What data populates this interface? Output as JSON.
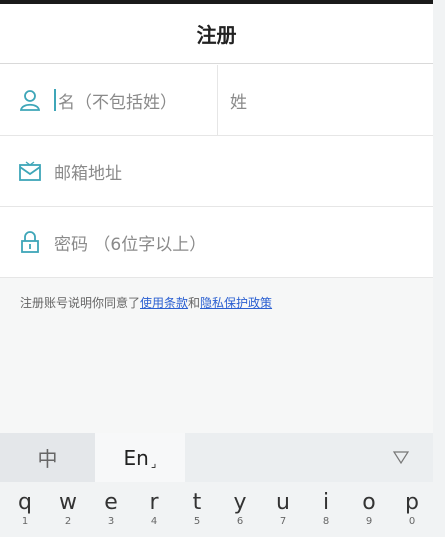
{
  "header": {
    "title": "注册"
  },
  "form": {
    "first_name_placeholder": "名（不包括姓）",
    "last_name_placeholder": "姓",
    "email_placeholder": "邮箱地址",
    "password_placeholder": "密码 （6位字以上）"
  },
  "terms": {
    "prefix": "注册账号说明你同意了",
    "terms_link": "使用条款",
    "and": "和",
    "privacy_link": "隐私保护政策"
  },
  "keyboard": {
    "tab_chinese": "中",
    "tab_english": "En",
    "english_mark": "⌟",
    "keys": [
      {
        "ch": "q",
        "num": "1"
      },
      {
        "ch": "w",
        "num": "2"
      },
      {
        "ch": "e",
        "num": "3"
      },
      {
        "ch": "r",
        "num": "4"
      },
      {
        "ch": "t",
        "num": "5"
      },
      {
        "ch": "y",
        "num": "6"
      },
      {
        "ch": "u",
        "num": "7"
      },
      {
        "ch": "i",
        "num": "8"
      },
      {
        "ch": "o",
        "num": "9"
      },
      {
        "ch": "p",
        "num": "0"
      }
    ]
  },
  "colors": {
    "accent": "#3ea6b8",
    "link": "#2a5fd1"
  }
}
